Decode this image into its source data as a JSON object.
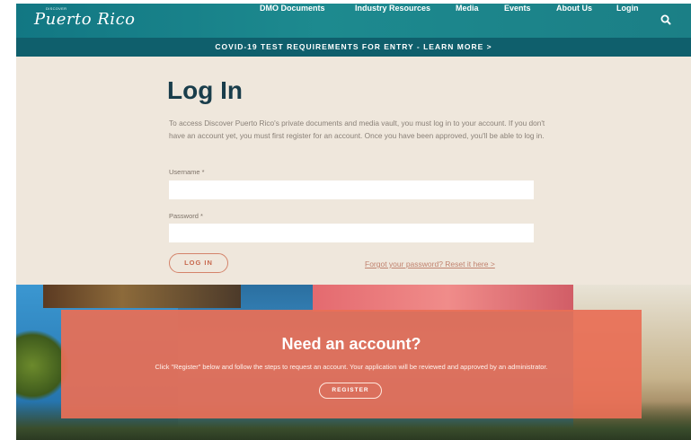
{
  "header": {
    "logo_text": "Puerto Rico",
    "logo_small": "DISCOVER",
    "nav": [
      {
        "label": "DMO Documents"
      },
      {
        "label": "Industry Resources"
      },
      {
        "label": "Media"
      },
      {
        "label": "Events"
      },
      {
        "label": "About Us"
      },
      {
        "label": "Login"
      }
    ],
    "search_icon": "search-icon"
  },
  "banner": {
    "text": "COVID-19 TEST REQUIREMENTS FOR ENTRY - LEARN MORE >"
  },
  "login": {
    "title": "Log In",
    "intro": "To access Discover Puerto Rico's private documents and media vault, you must log in to your account. If you don't have an account yet, you must first register for an account. Once you have been approved, you'll be able to log in.",
    "username_label": "Username *",
    "username_value": "",
    "password_label": "Password *",
    "password_value": "",
    "login_button": "LOG IN",
    "forgot_link": "Forgot your password? Reset it here >"
  },
  "register": {
    "title": "Need an account?",
    "text": "Click \"Register\" below and follow the steps to request an account. Your application will be reviewed and approved by an administrator.",
    "button": "REGISTER"
  },
  "colors": {
    "topbar": "#127783",
    "banner": "#0f5f6c",
    "main_bg": "#efe7dc",
    "title": "#193d4b",
    "accent": "#e86f56"
  }
}
